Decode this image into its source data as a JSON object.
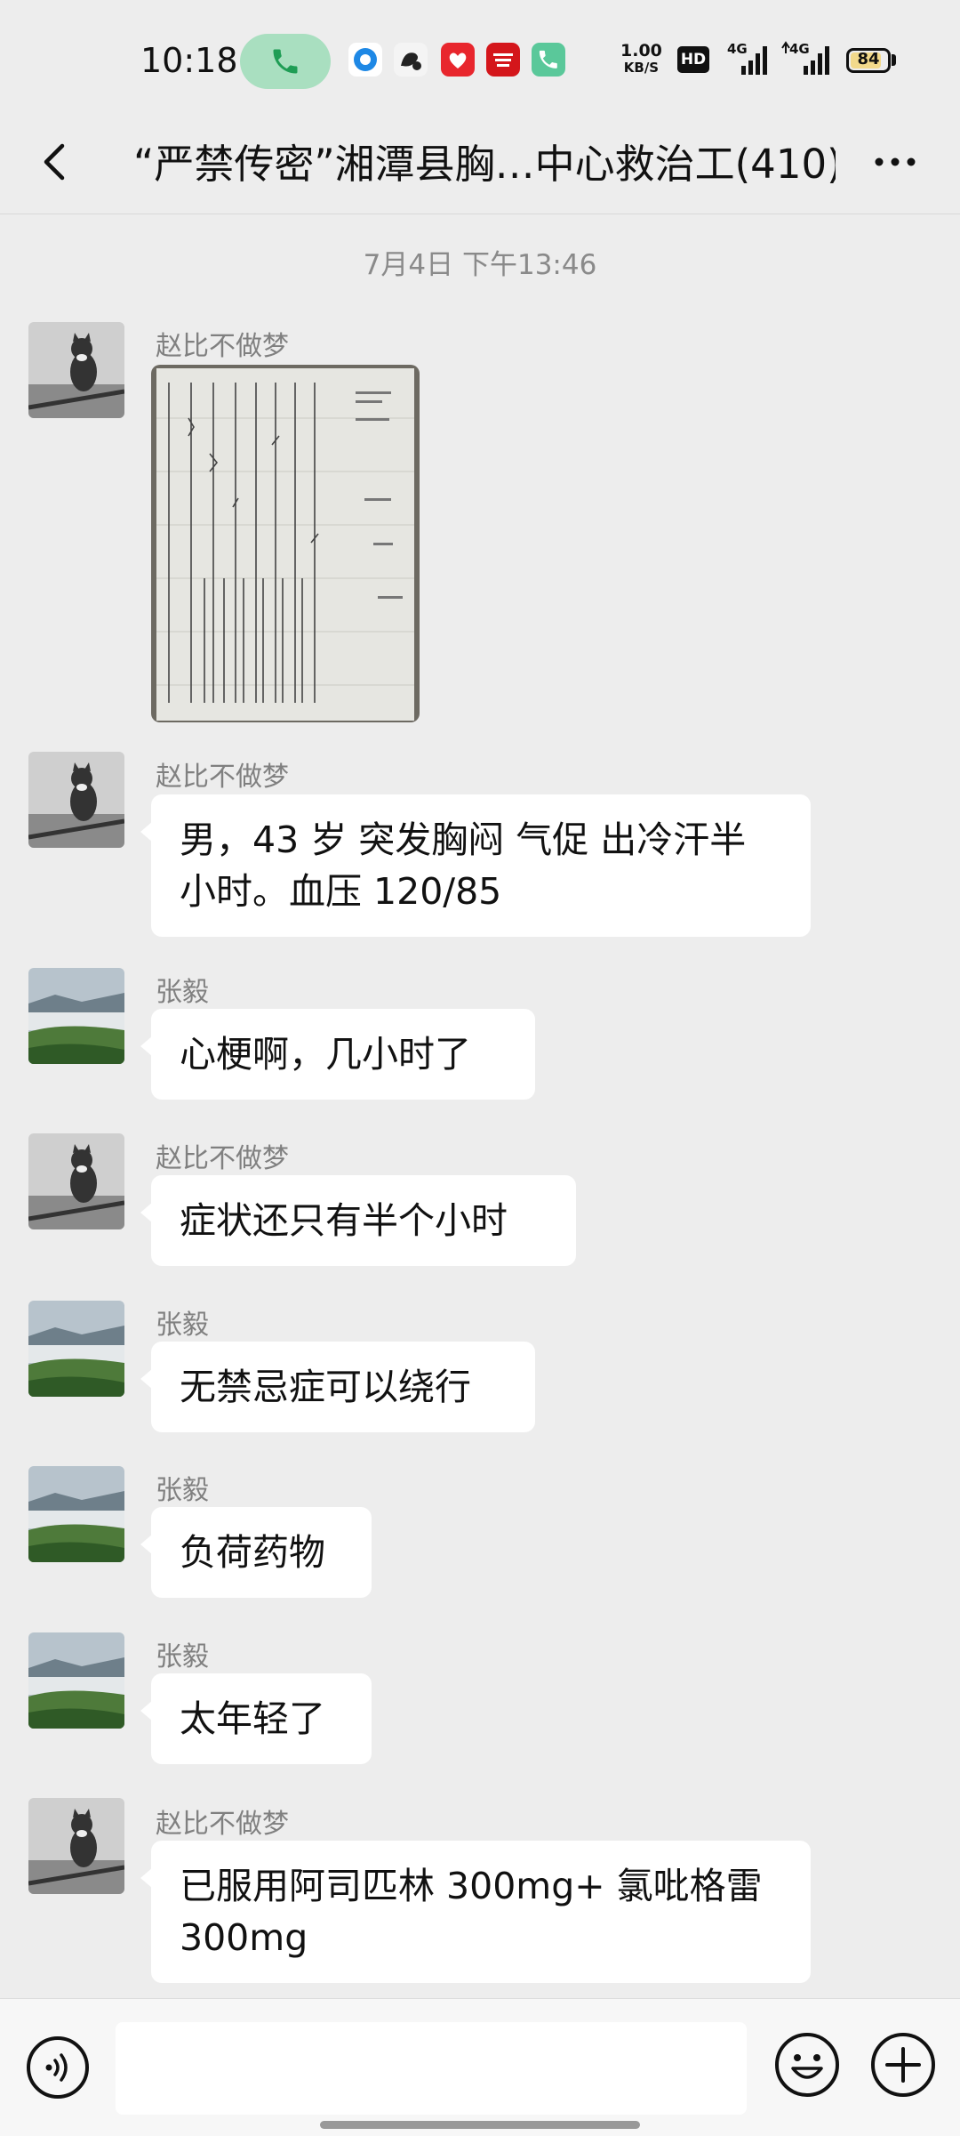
{
  "status": {
    "time": "10:18",
    "net_speed_value": "1.00",
    "net_speed_unit": "KB/S",
    "hd_label": "HD",
    "sig1_label": "4G",
    "sig2_label": "4G",
    "battery": "84",
    "battery_level": 0.84
  },
  "header": {
    "title": "“严禁传密”湘潭县胸…中心救治工(410)"
  },
  "timestamp": "7月4日 下午13:46",
  "messages": [
    {
      "sender": "赵比不做梦",
      "type": "image"
    },
    {
      "sender": "赵比不做梦",
      "text": "男，43 岁 突发胸闷 气促 出冷汗半小时。血压 120/85"
    },
    {
      "sender": "张毅",
      "text": "心梗啊，几小时了"
    },
    {
      "sender": "赵比不做梦",
      "text": "症状还只有半个小时"
    },
    {
      "sender": "张毅",
      "text": "无禁忌症可以绕行"
    },
    {
      "sender": "张毅",
      "text": "负荷药物"
    },
    {
      "sender": "张毅",
      "text": "太年轻了"
    },
    {
      "sender": "赵比不做梦",
      "text": "已服用阿司匹林 300mg+ 氯吡格雷 300mg"
    }
  ],
  "input": {
    "value": ""
  },
  "icons": {
    "back": "back-arrow-icon",
    "more": "more-icon",
    "voice": "voice-icon",
    "emoji": "emoji-icon",
    "plus": "plus-icon"
  },
  "colors": {
    "background": "#ededed",
    "bubble": "#ffffff",
    "call_pill": "#a9dfc0",
    "meta_text": "#808080"
  }
}
